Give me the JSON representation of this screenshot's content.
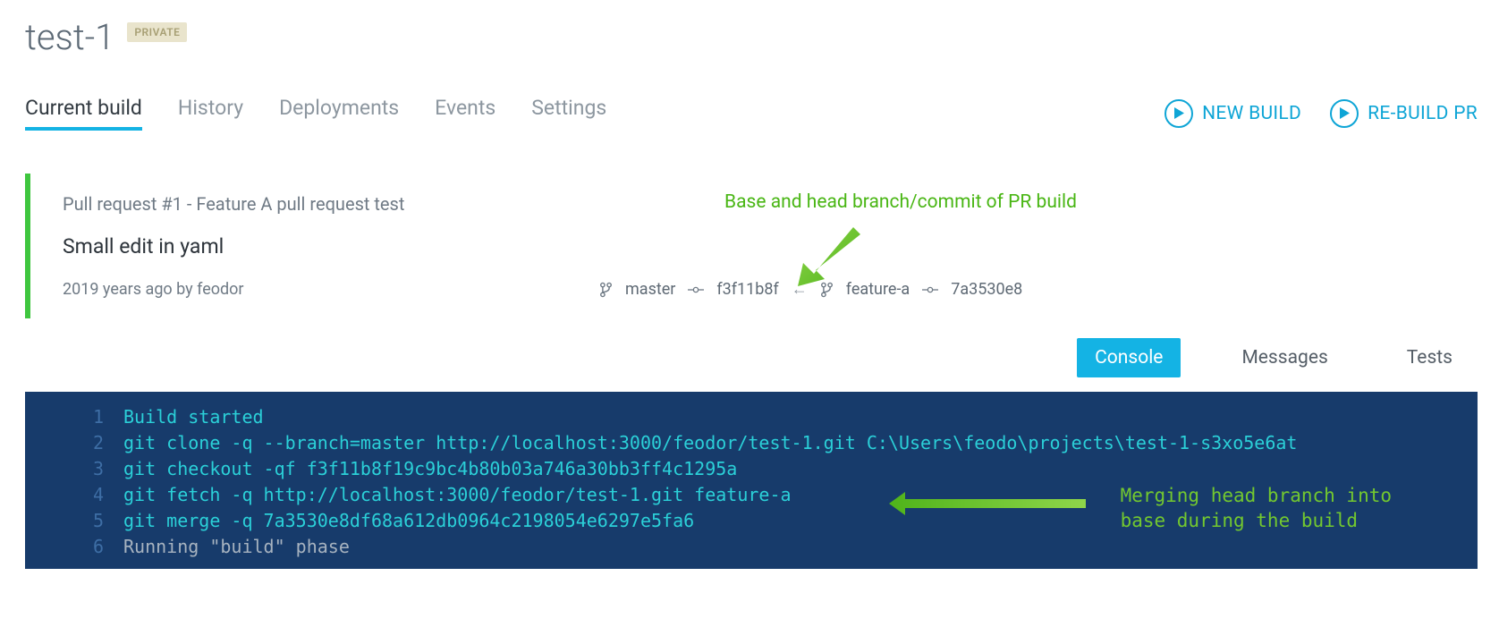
{
  "project": {
    "name": "test-1",
    "badge": "PRIVATE"
  },
  "tabs": {
    "current": "Current build",
    "history": "History",
    "deployments": "Deployments",
    "events": "Events",
    "settings": "Settings"
  },
  "actions": {
    "new_build": "NEW BUILD",
    "rebuild_pr": "RE-BUILD PR"
  },
  "build": {
    "pr_line": "Pull request #1 - Feature A pull request test",
    "commit_message": "Small edit in yaml",
    "time_author": "2019 years ago by feodor",
    "base_branch": "master",
    "base_commit": "f3f11b8f",
    "arrow": "←",
    "head_branch": "feature-a",
    "head_commit": "7a3530e8"
  },
  "annotations": {
    "top": "Base and head branch/commit of PR build",
    "bottom_line1": "Merging head branch into",
    "bottom_line2": "base during the build"
  },
  "output_tabs": {
    "console": "Console",
    "messages": "Messages",
    "tests": "Tests"
  },
  "console": {
    "lines": [
      {
        "n": "1",
        "cls": "cmd",
        "text": "Build started"
      },
      {
        "n": "2",
        "cls": "cmd",
        "text": "git clone -q --branch=master http://localhost:3000/feodor/test-1.git C:\\Users\\feodo\\projects\\test-1-s3xo5e6at"
      },
      {
        "n": "3",
        "cls": "cmd",
        "text": "git checkout -qf f3f11b8f19c9bc4b80b03a746a30bb3ff4c1295a"
      },
      {
        "n": "4",
        "cls": "cmd",
        "text": "git fetch -q http://localhost:3000/feodor/test-1.git feature-a"
      },
      {
        "n": "5",
        "cls": "cmd",
        "text": "git merge -q 7a3530e8df68a612db0964c2198054e6297e5fa6"
      },
      {
        "n": "6",
        "cls": "plain",
        "text": "Running \"build\" phase"
      }
    ]
  }
}
